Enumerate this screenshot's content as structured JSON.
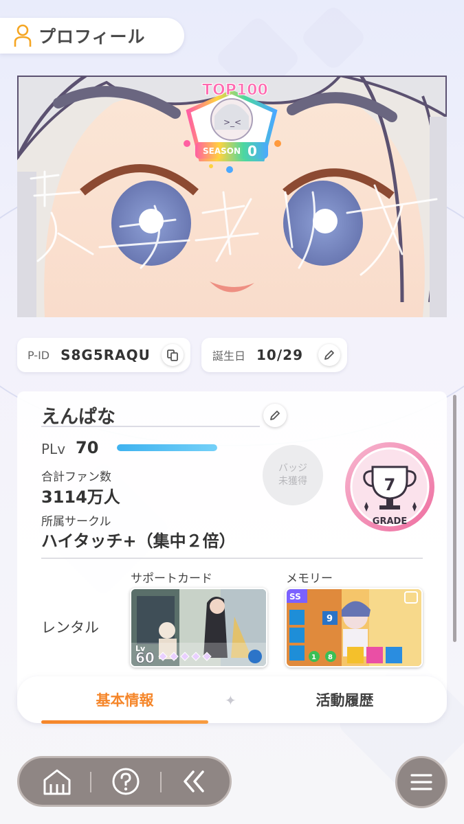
{
  "header": {
    "title": "プロフィール",
    "icon": "person-icon"
  },
  "banner": {
    "badge_top": "TOP100",
    "badge_season_label": "SEASON",
    "badge_season_num": "0",
    "signature": "葛城リーリャ"
  },
  "pid": {
    "label": "P-ID",
    "value": "S8G5RAQU",
    "icon": "copy-icon"
  },
  "birthday": {
    "label": "誕生日",
    "value": "10/29",
    "icon": "pencil-icon"
  },
  "profile": {
    "name": "えんぱな",
    "plv_label": "PLv",
    "plv_value": "70",
    "plv_progress": 1.0,
    "fans_label": "合計ファン数",
    "fans_value": "3114万人",
    "circle_label": "所属サークル",
    "circle_value": "ハイタッチ+（集中２倍）",
    "badge_line1": "バッジ",
    "badge_line2": "未獲得",
    "grade_number": "7",
    "grade_label": "GRADE"
  },
  "rental": {
    "label": "レンタル",
    "support_label": "サポートカード",
    "memory_label": "メモリー",
    "support_card": {
      "lv_label": "Lv",
      "lv_value": "60"
    },
    "memory_card": {
      "rank": "SS",
      "stat_a": "9",
      "stat_b": "1",
      "stat_c": "8"
    }
  },
  "tabs": [
    {
      "label": "基本情報",
      "active": true
    },
    {
      "label": "活動履歴",
      "active": false
    }
  ],
  "nav": [
    "home-icon",
    "help-icon",
    "back-icon",
    "menu-icon"
  ],
  "colors": {
    "accent": "#f5862a",
    "plv_bar": "#3fb2ef",
    "nav_bg": "#8f8684",
    "grade_pink": "#f07aa8"
  }
}
